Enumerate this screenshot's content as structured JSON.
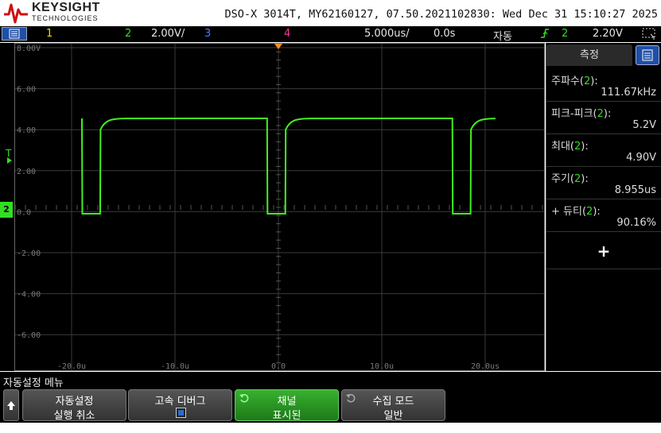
{
  "header": {
    "brand": "KEYSIGHT",
    "brand_sub": "TECHNOLOGIES",
    "info": "DSO-X 3014T, MY62160127, 07.50.2021102830: Wed Dec 31 15:10:27 2025"
  },
  "statusbar": {
    "ch1": "1",
    "ch2": "2",
    "ch2_scale": "2.00V/",
    "ch3": "3",
    "ch4": "4",
    "timebase": "5.000us/",
    "delay": "0.0s",
    "trigger_mode": "자동",
    "trigger_source": "2",
    "trigger_level": "2.20V",
    "colors": {
      "ch1": "#e8e000",
      "ch2": "#33dd22",
      "ch3": "#4a7cff",
      "ch4": "#ff3399"
    }
  },
  "scope": {
    "y_labels": [
      "8.00V",
      "6.00",
      "4.00",
      "2.00",
      "0.0",
      "-2.00",
      "-4.00",
      "-6.00"
    ],
    "x_labels": [
      "-20.0u",
      "-10.0u",
      "0.0",
      "10.0u",
      "20.0us"
    ],
    "trigger_marker": "T",
    "channel_marker": "2"
  },
  "measurements": {
    "tab_label": "측정",
    "items": [
      {
        "name": "주파수",
        "channel": "2",
        "value": "111.67kHz"
      },
      {
        "name": "피크-피크",
        "channel": "2",
        "value": "5.2V"
      },
      {
        "name": "최대",
        "channel": "2",
        "value": "4.90V"
      },
      {
        "name": "주기",
        "channel": "2",
        "value": "8.955us"
      },
      {
        "name": "+ 듀티",
        "channel": "2",
        "value": "90.16%"
      }
    ],
    "add_label": "+"
  },
  "softkeys": {
    "menu_title": "자동설정 메뉴",
    "keys": [
      {
        "line1": "자동설정",
        "line2": "실행 취소"
      },
      {
        "line1": "고속 디버그",
        "line2": ""
      },
      {
        "line1": "채널",
        "line2": "표시된"
      },
      {
        "line1": "수집 모드",
        "line2": "일반"
      }
    ]
  },
  "icons": {
    "back": "up-arrow-icon",
    "menu": "menu-icon",
    "trigger_edge": "rising-edge-icon",
    "cycle": "cycle-arrow-icon",
    "checkbox": "checkbox-icon",
    "screen": "screen-select-icon"
  }
}
